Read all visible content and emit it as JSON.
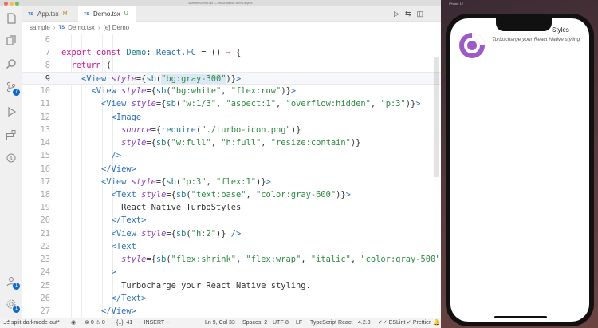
{
  "window": {
    "title": "sample/Demo.tsx — react-native-turbo-styles"
  },
  "activity_bar": {
    "items": [
      {
        "icon": "files-icon"
      },
      {
        "icon": "copy-icon"
      },
      {
        "icon": "search-icon"
      },
      {
        "icon": "source-control-icon",
        "badge": "7"
      },
      {
        "icon": "run-debug-icon"
      },
      {
        "icon": "extensions-icon"
      },
      {
        "icon": "remote-icon"
      }
    ],
    "account_badge": "1",
    "settings_badge": "1"
  },
  "tabs": [
    {
      "label": "App.tsx",
      "icon": "TS",
      "state": "M"
    },
    {
      "label": "Demo.tsx",
      "icon": "TS",
      "state": "U"
    }
  ],
  "breadcrumb": {
    "folder": "sample",
    "file": "Demo.tsx",
    "symbol": "[e] Demo"
  },
  "editor": {
    "line_numbers": [
      "6",
      "7",
      "8",
      "9",
      "10",
      "11",
      "12",
      "13",
      "14",
      "15",
      "16",
      "17",
      "18",
      "19",
      "20",
      "21",
      "22",
      "23",
      "24",
      "25",
      "26",
      "27"
    ],
    "current_line": "9"
  },
  "statusbar": {
    "branch": "split-darkmode-out*",
    "errors": "0",
    "warnings": "0",
    "selection": "{..}: 41",
    "mode": "-- INSERT --",
    "position": "Ln 9, Col 33",
    "spaces": "Spaces: 2",
    "encoding": "UTF-8",
    "eol": "LF",
    "language": "TypeScript React",
    "ts_version": "4.2.3",
    "eslint": "ESLint",
    "prettier": "Prettier"
  },
  "simulator": {
    "window_title": "iPhone 12",
    "app_title": "Styles",
    "app_subtitle": "Turbocharge your React Native styling."
  },
  "colors": {
    "keyword": "#c5168f",
    "tag": "#2b6fb6",
    "string": "#2b8a3e",
    "attribute": "#8e3fbf",
    "badge": "#0a6ad3",
    "logo": "#9b59c9"
  }
}
